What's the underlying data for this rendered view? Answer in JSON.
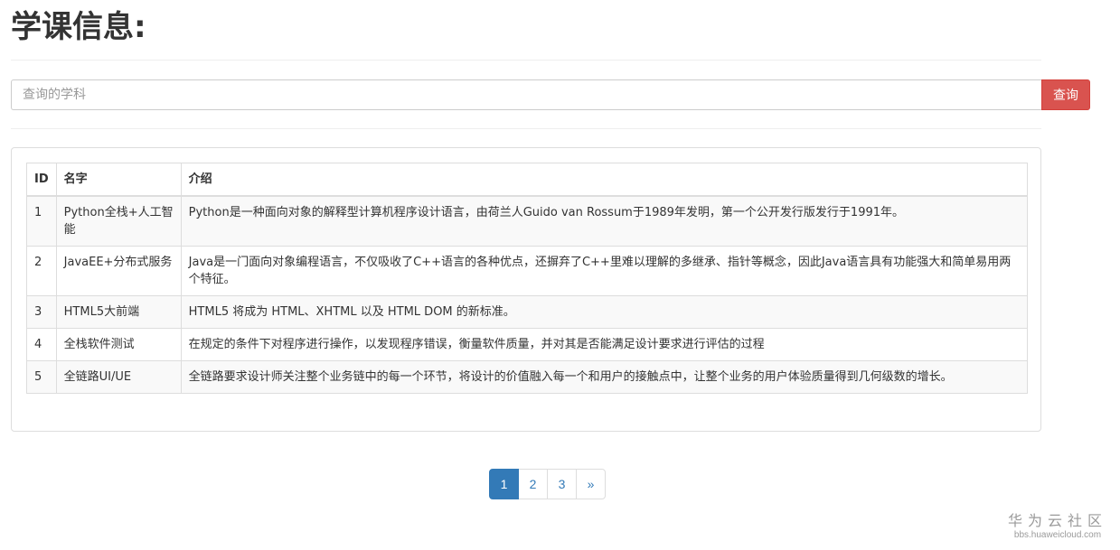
{
  "header": {
    "title": "学课信息:"
  },
  "search": {
    "placeholder": "查询的学科",
    "value": "",
    "button_label": "查询"
  },
  "table": {
    "columns": [
      "ID",
      "名字",
      "介绍"
    ],
    "rows": [
      {
        "id": "1",
        "name": "Python全栈+人工智能",
        "intro": "Python是一种面向对象的解释型计算机程序设计语言，由荷兰人Guido van Rossum于1989年发明，第一个公开发行版发行于1991年。"
      },
      {
        "id": "2",
        "name": "JavaEE+分布式服务",
        "intro": "Java是一门面向对象编程语言，不仅吸收了C++语言的各种优点，还摒弃了C++里难以理解的多继承、指针等概念，因此Java语言具有功能强大和简单易用两个特征。"
      },
      {
        "id": "3",
        "name": "HTML5大前端",
        "intro": "HTML5 将成为 HTML、XHTML 以及 HTML DOM 的新标准。"
      },
      {
        "id": "4",
        "name": "全栈软件测试",
        "intro": "在规定的条件下对程序进行操作，以发现程序错误，衡量软件质量，并对其是否能满足设计要求进行评估的过程"
      },
      {
        "id": "5",
        "name": "全链路UI/UE",
        "intro": "全链路要求设计师关注整个业务链中的每一个环节，将设计的价值融入每一个和用户的接触点中，让整个业务的用户体验质量得到几何级数的增长。"
      }
    ]
  },
  "pagination": {
    "pages": [
      "1",
      "2",
      "3"
    ],
    "active": "1",
    "next_label": "»"
  },
  "watermark": {
    "main": "华为云社区",
    "sub": "bbs.huaweicloud.com"
  },
  "colors": {
    "accent": "#337ab7",
    "danger": "#d9534f"
  }
}
